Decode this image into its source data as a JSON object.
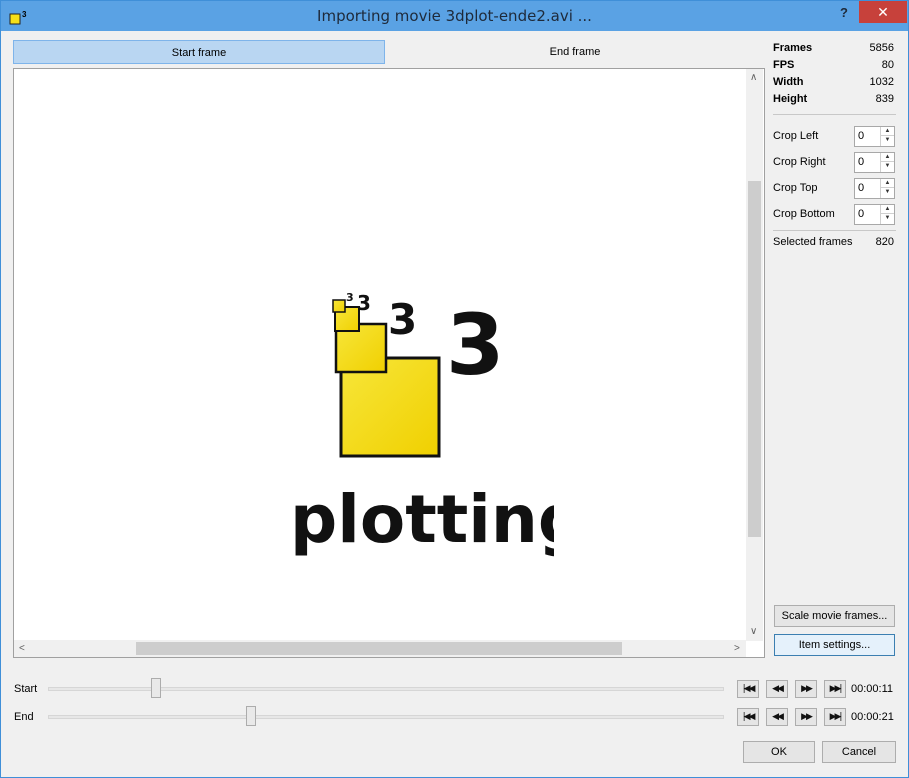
{
  "window": {
    "title": "Importing movie 3dplot-ende2.avi ...",
    "help_label": "?",
    "close_label": "✕",
    "app_icon": "qtiplot-cube-icon"
  },
  "tabs": [
    {
      "label": "Start frame",
      "active": true
    },
    {
      "label": "End frame",
      "active": false
    }
  ],
  "preview": {
    "logo_glyph": "3",
    "logo_small_glyph": "3",
    "caption": "plotting",
    "logo_color": "#f5e01a"
  },
  "info": {
    "frames_label": "Frames",
    "frames_value": "5856",
    "fps_label": "FPS",
    "fps_value": "80",
    "width_label": "Width",
    "width_value": "1032",
    "height_label": "Height",
    "height_value": "839"
  },
  "crop": [
    {
      "label": "Crop Left",
      "value": "0"
    },
    {
      "label": "Crop Right",
      "value": "0"
    },
    {
      "label": "Crop Top",
      "value": "0"
    },
    {
      "label": "Crop Bottom",
      "value": "0"
    }
  ],
  "selected": {
    "label": "Selected frames",
    "value": "820"
  },
  "buttons": {
    "scale": "Scale movie frames...",
    "item_settings": "Item settings...",
    "ok": "OK",
    "cancel": "Cancel"
  },
  "sliders": {
    "start": {
      "label": "Start",
      "time": "00:00:11",
      "position": 0.16
    },
    "end": {
      "label": "End",
      "time": "00:00:21",
      "position": 0.3
    }
  },
  "nav_buttons": {
    "first": "|◀◀",
    "prev": "◀◀",
    "next": "▶▶",
    "last": "▶▶|"
  },
  "scroll_arrows": {
    "up": "∧",
    "down": "∨",
    "left": "<",
    "right": ">"
  }
}
